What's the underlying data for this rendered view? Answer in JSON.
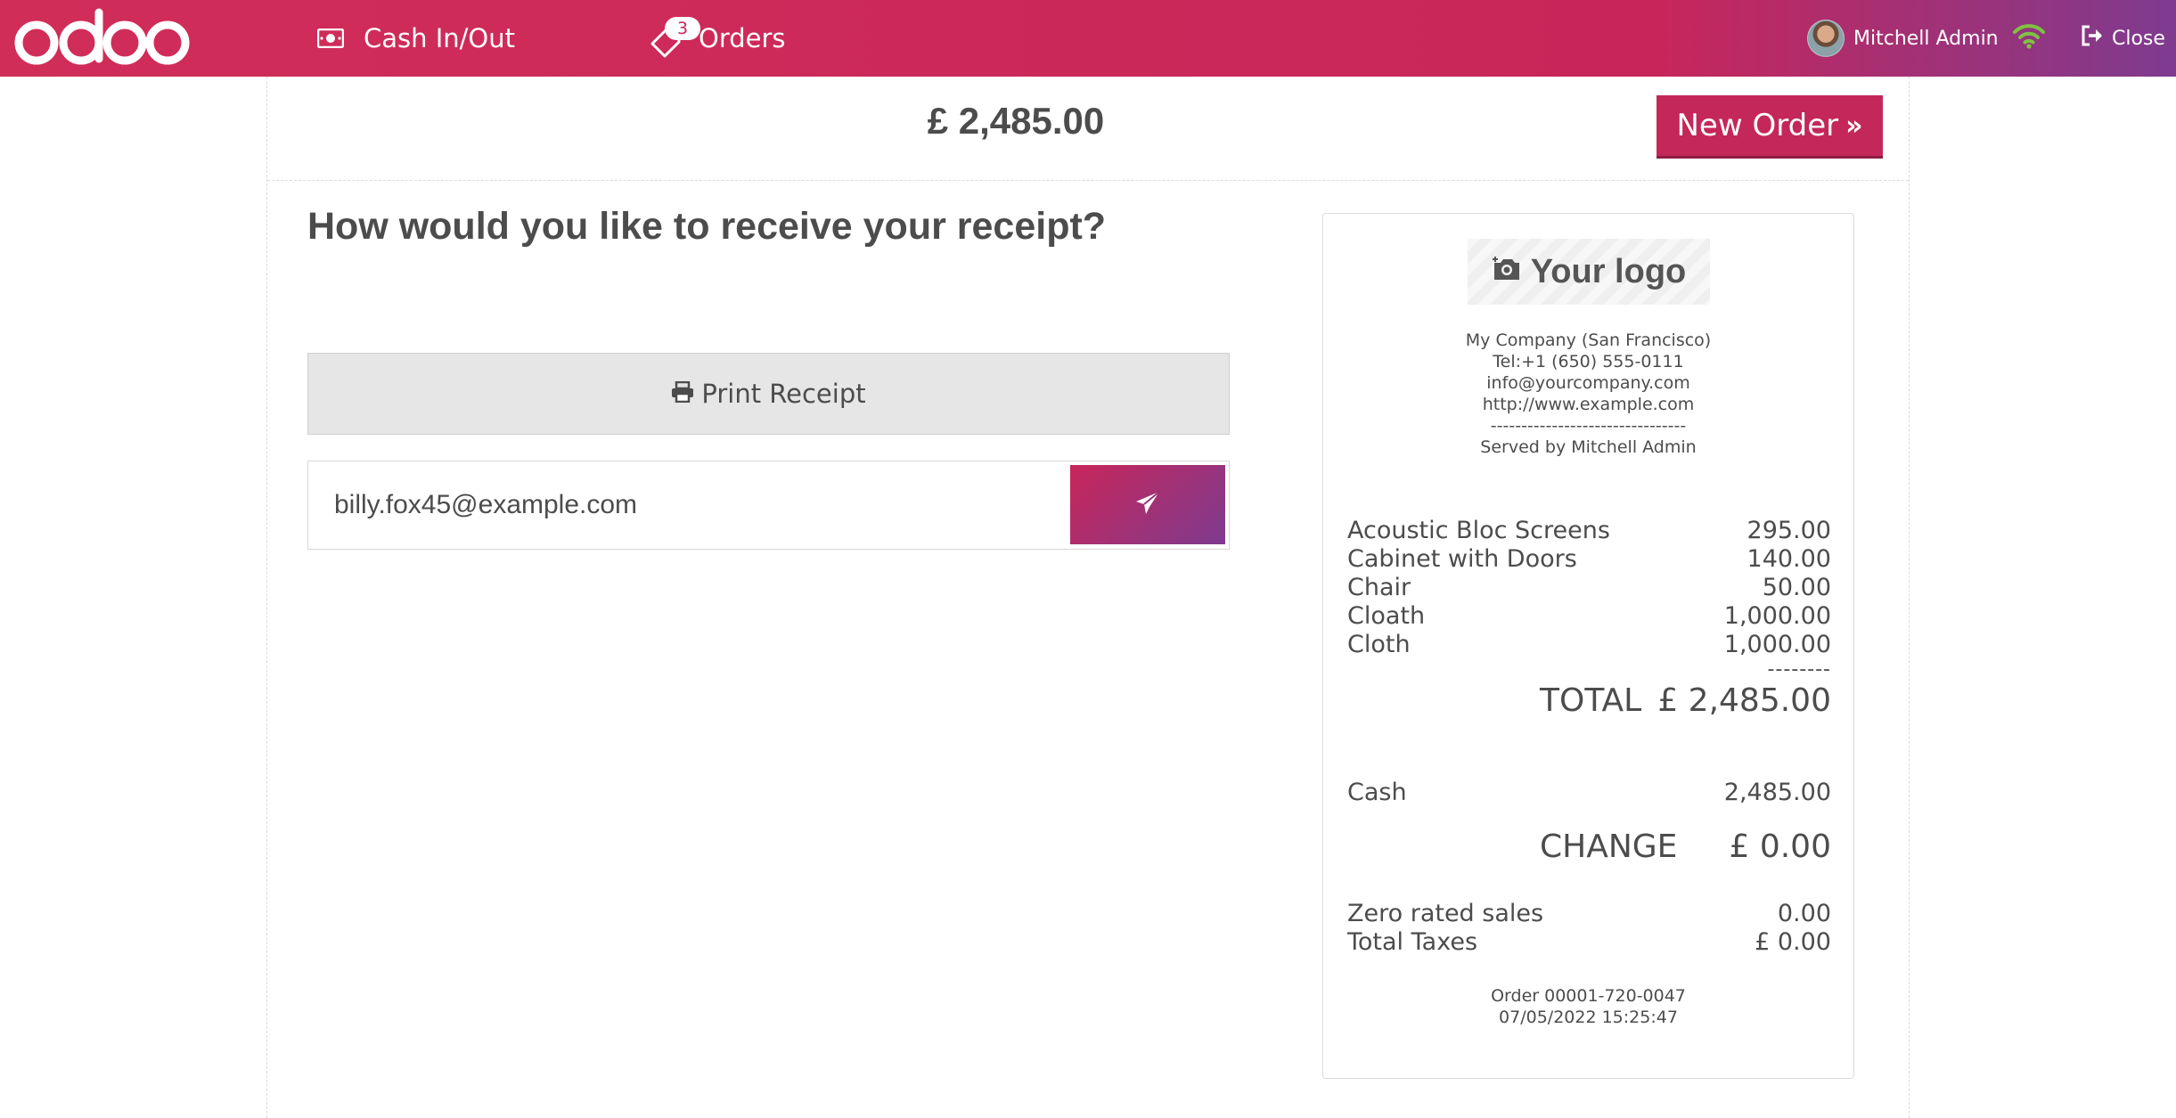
{
  "app": {
    "brand": "odoo",
    "accent_color": "#c4275a",
    "secondary_color": "#7e3b8f"
  },
  "header": {
    "cash_in_out_label": "Cash In/Out",
    "orders_label": "Orders",
    "orders_badge": "3",
    "user_name": "Mitchell Admin",
    "close_label": "Close",
    "icons": [
      "money-icon",
      "tag-icon",
      "wifi-icon",
      "sign-out-icon"
    ]
  },
  "payment": {
    "amount_due": "£ 2,485.00",
    "new_order_label": "New Order",
    "question": "How would you like to receive your receipt?",
    "print_label": "Print Receipt",
    "email_value": "billy.fox45@example.com"
  },
  "receipt": {
    "logo_text": "Your logo",
    "company": "My Company (San Francisco)",
    "tel": "Tel:+1 (650) 555-0111",
    "email": "info@yourcompany.com",
    "website": "http://www.example.com",
    "separator": "--------------------------------",
    "served_by": "Served by Mitchell Admin",
    "lines": [
      {
        "name": "Acoustic Bloc Screens",
        "amount": "295.00"
      },
      {
        "name": "Cabinet with Doors",
        "amount": "140.00"
      },
      {
        "name": "Chair",
        "amount": "50.00"
      },
      {
        "name": "Cloath",
        "amount": "1,000.00"
      },
      {
        "name": "Cloth",
        "amount": "1,000.00"
      }
    ],
    "total_dashes": "--------",
    "total_label": "TOTAL",
    "total_value": "£ 2,485.00",
    "payment_method": "Cash",
    "payment_amount": "2,485.00",
    "change_label": "CHANGE",
    "change_value": "£ 0.00",
    "zero_rated_label": "Zero rated sales",
    "zero_rated_value": "0.00",
    "total_taxes_label": "Total Taxes",
    "total_taxes_value": "£ 0.00",
    "order_ref": "Order 00001-720-0047",
    "order_date": "07/05/2022 15:25:47"
  }
}
